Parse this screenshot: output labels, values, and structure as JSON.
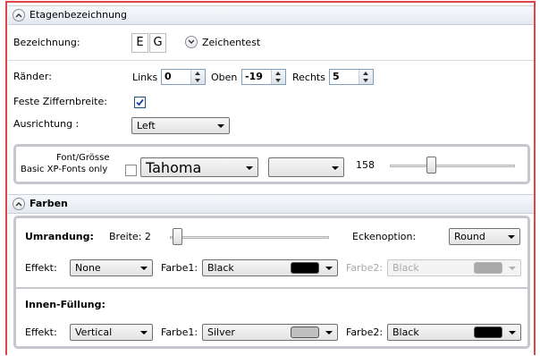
{
  "section_etagen": {
    "title": "Etagenbezeichnung"
  },
  "bezeichnung": {
    "label": "Bezeichnung:",
    "letter1": "E",
    "letter2": "G",
    "zeichentest_label": "Zeichentest"
  },
  "raender": {
    "label": "Ränder:",
    "links_label": "Links",
    "links_value": "0",
    "oben_label": "Oben",
    "oben_value": "-19",
    "rechts_label": "Rechts",
    "rechts_value": "5"
  },
  "feste_ziffernbreite": {
    "label": "Feste Ziffernbreite:",
    "checked": true
  },
  "ausrichtung": {
    "label": "Ausrichtung :",
    "value": "Left"
  },
  "font": {
    "label_line1": "Font/Grösse",
    "label_line2": "Basic XP-Fonts only",
    "basic_xp_checked": false,
    "font_value": "Tahoma",
    "size_value": "",
    "size_number": "158",
    "size_slider_fraction": 0.32
  },
  "section_farben": {
    "title": "Farben"
  },
  "umrandung": {
    "label": "Umrandung:",
    "breite_label": "Breite: 2",
    "breite_slider_fraction": 0.0,
    "eckenoption_label": "Eckenoption:",
    "eckenoption_value": "Round",
    "effekt_label": "Effekt:",
    "effekt_value": "None",
    "farbe1_label": "Farbe1:",
    "farbe1_value": "Black",
    "farbe1_color": "#000000",
    "farbe2_label": "Farbe2:",
    "farbe2_value": "Black",
    "farbe2_color": "#a9a9a9"
  },
  "innen_fuellung": {
    "label": "Innen-Füllung:",
    "effekt_label": "Effekt:",
    "effekt_value": "Vertical",
    "farbe1_label": "Farbe1:",
    "farbe1_value": "Silver",
    "farbe1_color": "#c0c0c0",
    "farbe2_label": "Farbe2:",
    "farbe2_value": "Black",
    "farbe2_color": "#000000"
  },
  "colors": {
    "accent_border": "#e0454a",
    "group_border": "#c4c7cc"
  }
}
